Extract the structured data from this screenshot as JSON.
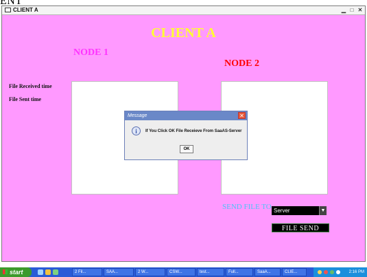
{
  "top_text": "ENT",
  "window": {
    "title": "CLIENT A",
    "controls": [
      "minimize-icon",
      "maximize-icon",
      "close-icon"
    ]
  },
  "heading": "CLIENT A",
  "node1_label": "NODE 1",
  "node2_label": "NODE 2",
  "file_received_label": "File Received time",
  "file_sent_label": "File Sent time",
  "send_file_label": "SEND FILE TO",
  "server_combo": {
    "selected": "Server"
  },
  "file_send_button": "FILE  SEND",
  "dialog": {
    "title": "Message",
    "message": "If You Click OK File Receieve From SaaAS-Server",
    "ok_label": "OK"
  },
  "taskbar": {
    "start_label": "start",
    "tasks": [
      "2 Fil...",
      "SAA...",
      "2 W...",
      "CSW...",
      "test...",
      "Full...",
      "SaaA...",
      "CLIE..."
    ],
    "clock": "2:16 PM"
  },
  "colors": {
    "window_bg": "#ff99ff",
    "heading": "#ffff33",
    "node1": "#ff33ff",
    "node2": "#ff0000",
    "send_label": "#4fc3f7"
  }
}
